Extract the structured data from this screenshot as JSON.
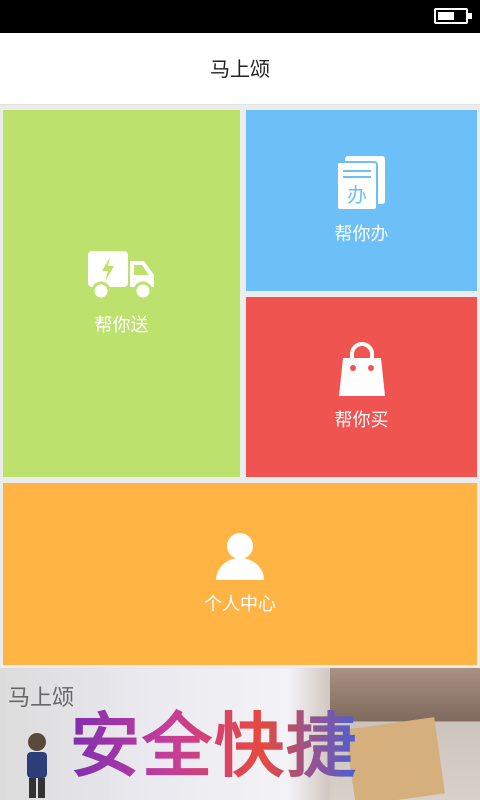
{
  "status_bar": {
    "battery_level": 0.6
  },
  "app": {
    "title": "马上颂"
  },
  "tiles": [
    {
      "label": "帮你送",
      "icon": "delivery-truck-icon",
      "color": "#bde16d"
    },
    {
      "label": "帮你办",
      "icon": "documents-icon",
      "icon_text": "办",
      "color": "#6dc0f7"
    },
    {
      "label": "帮你买",
      "icon": "shopping-bag-icon",
      "color": "#f05451"
    },
    {
      "label": "个人中心",
      "icon": "person-icon",
      "color": "#ffb444"
    }
  ],
  "banner": {
    "logo_text": "马上颂",
    "slogan": "安全快捷"
  }
}
